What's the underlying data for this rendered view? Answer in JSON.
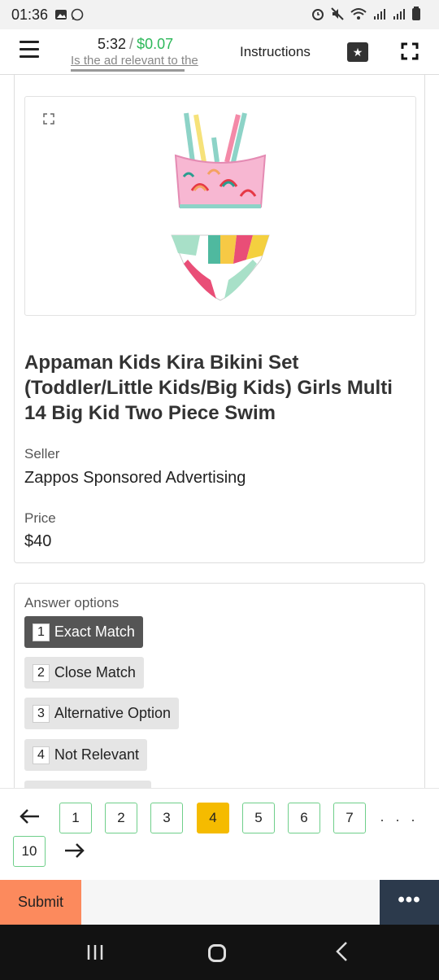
{
  "status_bar": {
    "time": "01:36"
  },
  "header": {
    "timer": "5:32",
    "separator": "/",
    "reward": "$0.07",
    "question": "Is the ad relevant to the",
    "instructions_label": "Instructions",
    "star_icon": "star-icon",
    "fullscreen_icon": "fullscreen-icon"
  },
  "product": {
    "title": "Appaman Kids Kira Bikini Set (Toddler/Little Kids/Big Kids) Girls Multi 14 Big Kid Two Piece Swim",
    "seller_label": "Seller",
    "seller_value": "Zappos Sponsored Advertising",
    "price_label": "Price",
    "price_value": "$40"
  },
  "answers": {
    "title": "Answer options",
    "options": [
      {
        "key": "1",
        "label": "Exact Match",
        "selected": true
      },
      {
        "key": "2",
        "label": "Close Match",
        "selected": false
      },
      {
        "key": "3",
        "label": "Alternative Option",
        "selected": false
      },
      {
        "key": "4",
        "label": "Not Relevant",
        "selected": false
      }
    ]
  },
  "pager": {
    "pages": [
      "1",
      "2",
      "3",
      "4",
      "5",
      "6",
      "7"
    ],
    "active_page": "4",
    "extra_page": "10",
    "ellipsis": "· · ·"
  },
  "footer": {
    "submit_label": "Submit",
    "more_label": "•••"
  },
  "colors": {
    "reward_green": "#2db85a",
    "active_page": "#f5bb00",
    "submit": "#fc8a5d",
    "more": "#2c3a4c"
  }
}
